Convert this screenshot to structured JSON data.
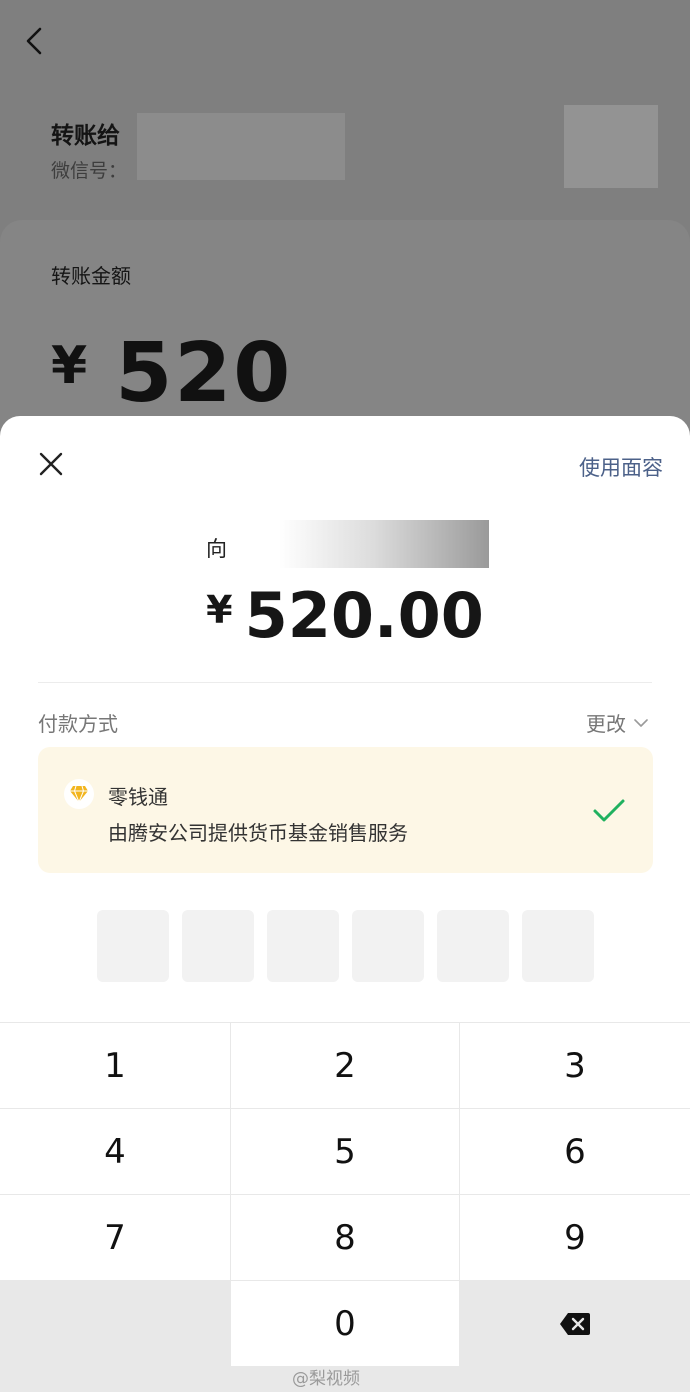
{
  "background_page": {
    "transfer_to_label": "转账给",
    "wechat_id_label": "微信号：",
    "amount_label": "转账金额",
    "amount_currency": "¥",
    "amount_value": "520"
  },
  "sheet": {
    "face_pay_label": "使用面容",
    "payee_prefix": "向",
    "amount_currency": "¥",
    "amount_value": "520.00",
    "payment_method_label": "付款方式",
    "change_label": "更改",
    "method": {
      "name": "零钱通",
      "description": "由腾安公司提供货币基金销售服务",
      "icon": "diamond-icon"
    },
    "pin_slots": 6
  },
  "keypad": {
    "keys": [
      "1",
      "2",
      "3",
      "4",
      "5",
      "6",
      "7",
      "8",
      "9",
      "",
      "0",
      "backspace"
    ]
  },
  "watermark": "@梨视频",
  "colors": {
    "link_blue": "#4c6189",
    "check_green": "#20b15f",
    "method_bg": "#fdf7e6",
    "diamond_gold": "#f2b51e"
  }
}
